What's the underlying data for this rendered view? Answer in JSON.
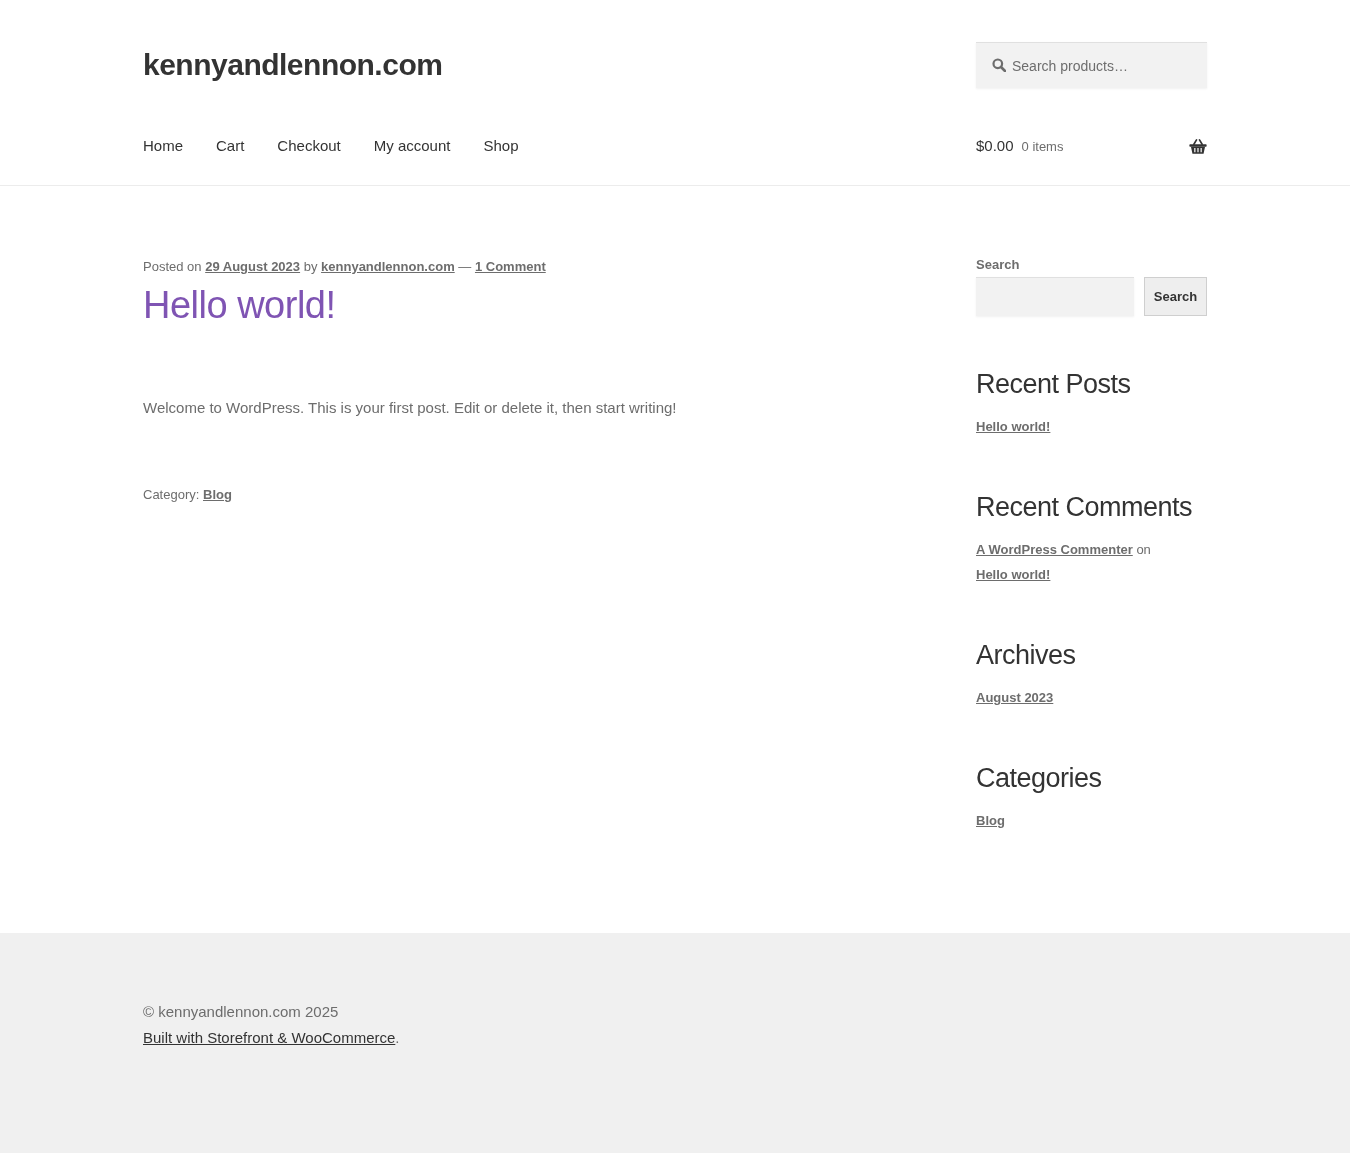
{
  "site": {
    "title": "kennyandlennon.com"
  },
  "product_search": {
    "placeholder": "Search products…"
  },
  "nav": [
    {
      "label": "Home"
    },
    {
      "label": "Cart"
    },
    {
      "label": "Checkout"
    },
    {
      "label": "My account"
    },
    {
      "label": "Shop"
    }
  ],
  "cart": {
    "total": "$0.00",
    "count": "0 items"
  },
  "post": {
    "meta": [
      {
        "kind": "text",
        "text": "Posted on"
      },
      {
        "kind": "link",
        "text": "29 August 2023"
      },
      {
        "kind": "text",
        "text": "by"
      },
      {
        "kind": "link",
        "text": "kennyandlennon.com"
      },
      {
        "kind": "text",
        "text": "—"
      },
      {
        "kind": "link",
        "text": "1 Comment"
      }
    ],
    "title": "Hello world!",
    "body": "Welcome to WordPress. This is your first post. Edit or delete it, then start writing!",
    "category": [
      {
        "kind": "text",
        "text": "Category:"
      },
      {
        "kind": "link",
        "text": "Blog"
      }
    ]
  },
  "sidebar": {
    "widgets": [
      {
        "kind": "search",
        "label": "Search",
        "button": "Search"
      },
      {
        "kind": "links",
        "title": "Recent Posts",
        "items": [
          "Hello world!"
        ]
      },
      {
        "kind": "comments",
        "title": "Recent Comments",
        "items": [
          {
            "parts": [
              {
                "kind": "link",
                "text": "A WordPress Commenter"
              },
              {
                "kind": "text",
                "text": "on"
              },
              {
                "kind": "link",
                "text": "Hello world!"
              }
            ]
          }
        ]
      },
      {
        "kind": "links",
        "title": "Archives",
        "items": [
          "August 2023"
        ]
      },
      {
        "kind": "links",
        "title": "Categories",
        "items": [
          "Blog"
        ]
      }
    ]
  },
  "footer": {
    "copyright": "© kennyandlennon.com 2025",
    "credit_link": "Built with Storefront & WooCommerce",
    "credit_suffix": "."
  }
}
